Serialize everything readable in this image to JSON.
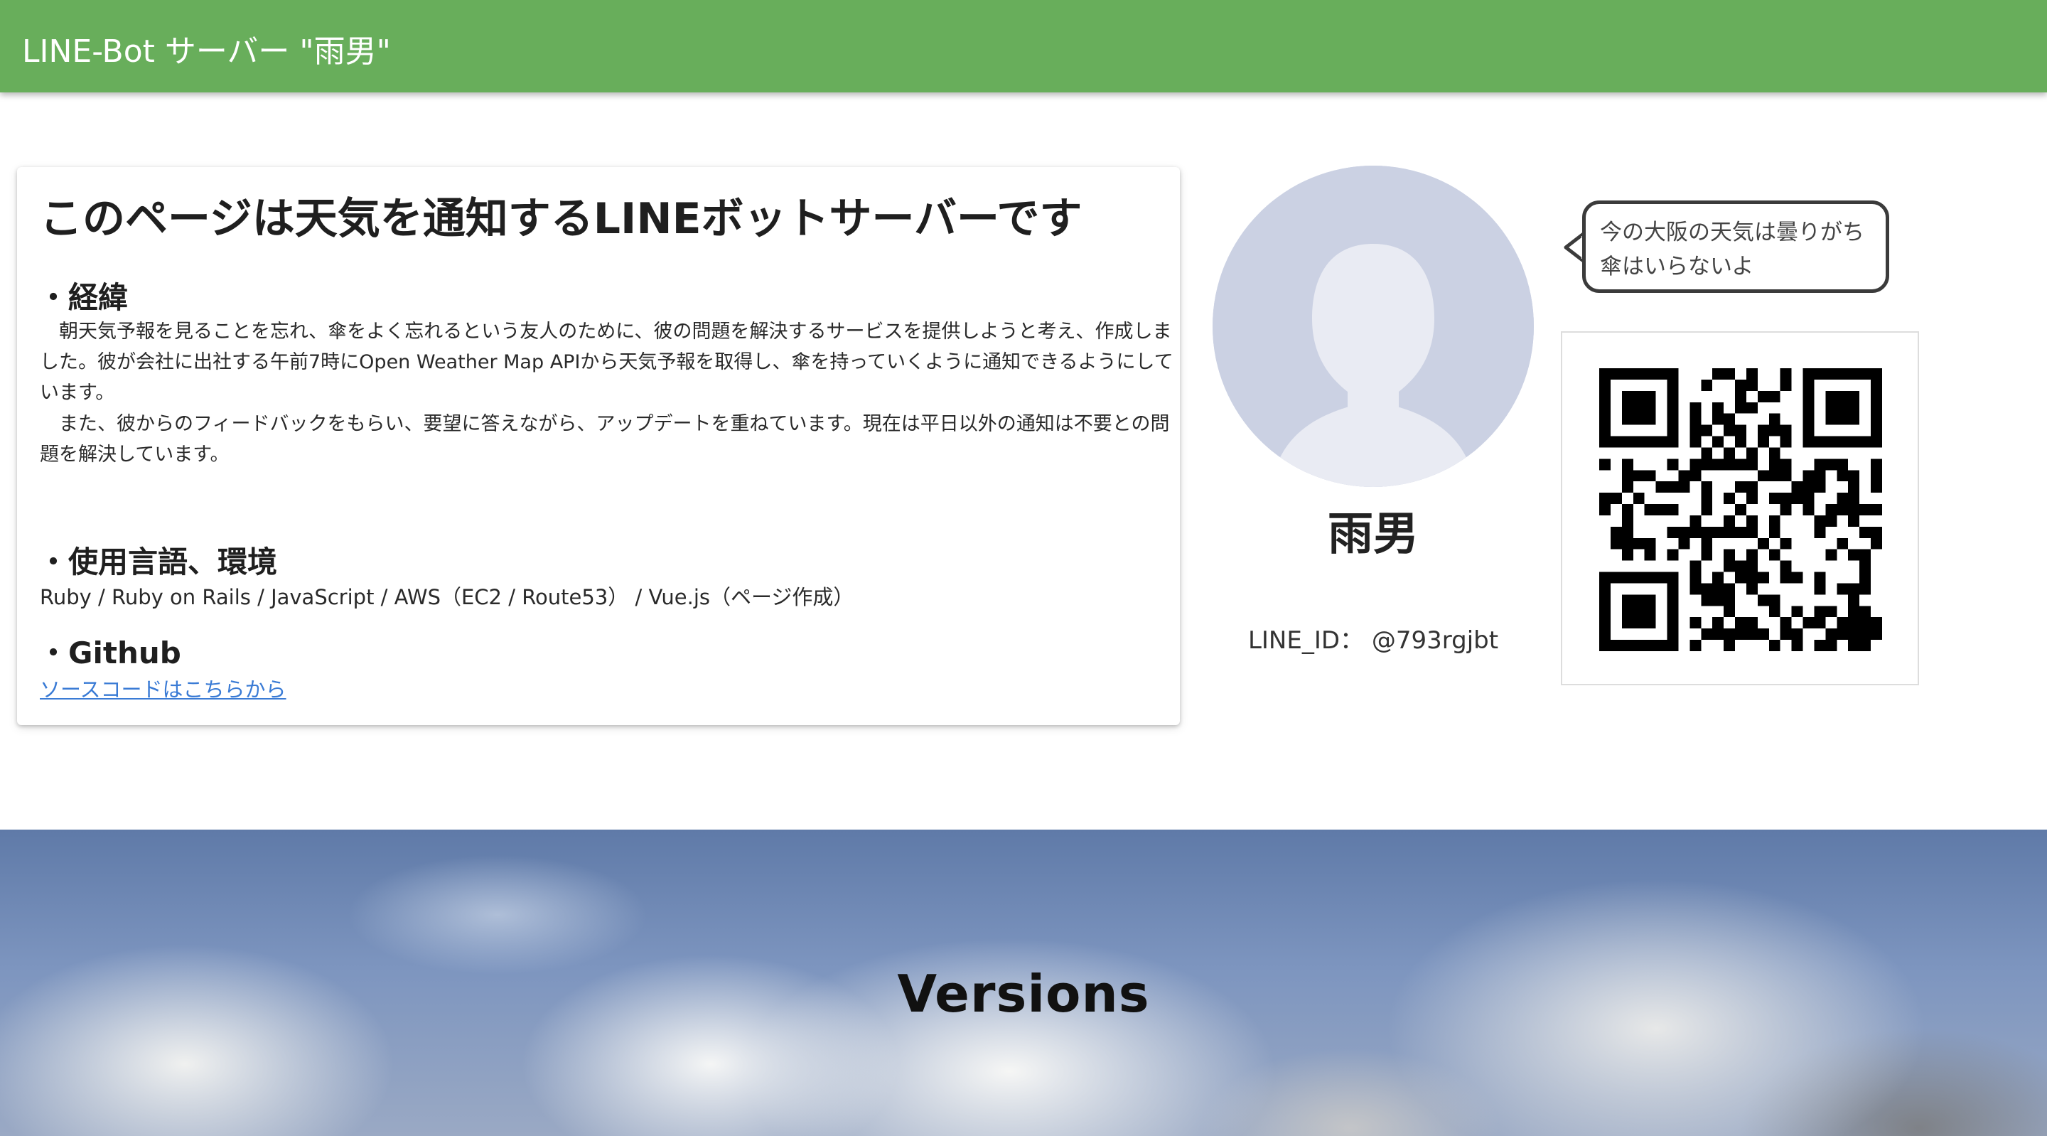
{
  "appbar": {
    "title": "LINE-Bot サーバー \"雨男\""
  },
  "intro": {
    "title": "このページは天気を通知するLINEボットサーバーです",
    "background_heading": "・経緯",
    "background_p1": "　朝天気予報を見ることを忘れ、傘をよく忘れるという友人のために、彼の問題を解決するサービスを提供しようと考え、作成しました。彼が会社に出社する午前7時にOpen Weather Map APIから天気予報を取得し、傘を持っていくように通知できるようにしています。",
    "background_p2": "　また、彼からのフィードバックをもらい、要望に答えながら、アップデートを重ねています。現在は平日以外の通知は不要との問題を解決しています。",
    "env_heading": "・使用言語、環境",
    "env_text": "Ruby / Ruby on Rails / JavaScript / AWS（EC2 / Route53） / Vue.js（ページ作成）",
    "github_heading": "・Github",
    "github_link": "ソースコードはこちらから"
  },
  "profile": {
    "name": "雨男",
    "line_id": "LINE_ID： @793rgjbt",
    "bubble_line1": "今の大阪の天気は曇りがち",
    "bubble_line2": "傘はいらないよ"
  },
  "hero": {
    "title": "Versions"
  },
  "colors": {
    "appbar": "#68ae5b",
    "link": "#3a7bd5",
    "avatar_bg": "#cbd1e3"
  },
  "icons": {
    "avatar": "user-silhouette-icon",
    "qr": "qr-code"
  }
}
